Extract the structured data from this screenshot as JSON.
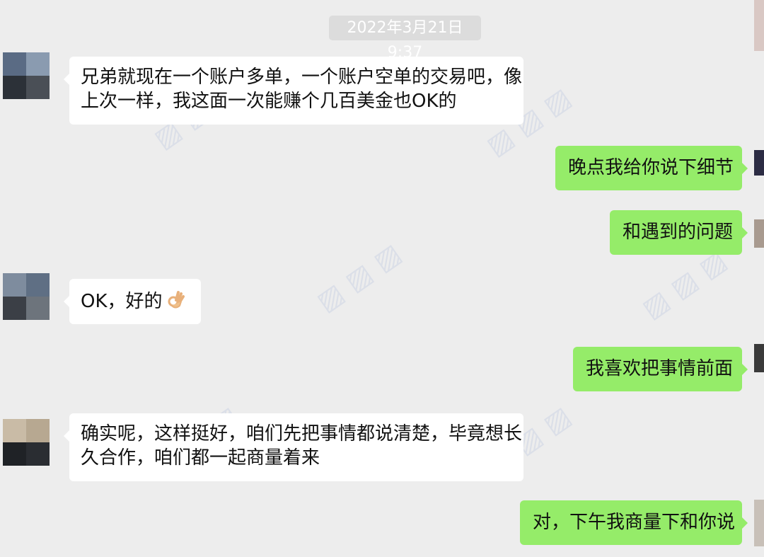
{
  "timestamp": "2022年3月21日 9:37",
  "messages": [
    {
      "side": "incoming",
      "lines": [
        "兄弟就现在一个账户多单，一个账户空单的交易吧，像",
        "上次一样，我这面一次能赚个几百美金也OK的"
      ]
    },
    {
      "side": "outgoing",
      "text": "晚点我给你说下细节"
    },
    {
      "side": "outgoing",
      "text": "和遇到的问题"
    },
    {
      "side": "incoming",
      "text": "OK，好的",
      "emoji": "ok-hand-icon"
    },
    {
      "side": "outgoing",
      "text": "我喜欢把事情前面"
    },
    {
      "side": "incoming",
      "lines": [
        "确实呢，这样挺好，咱们先把事情都说清楚，毕竟想长",
        "久合作，咱们都一起商量着来"
      ]
    },
    {
      "side": "outgoing",
      "text": "对，下午我商量下和你说"
    }
  ],
  "colors": {
    "background": "#ededed",
    "incoming_bubble": "#ffffff",
    "outgoing_bubble": "#95ec69",
    "timestamp_bg": "#dcdcdc"
  }
}
